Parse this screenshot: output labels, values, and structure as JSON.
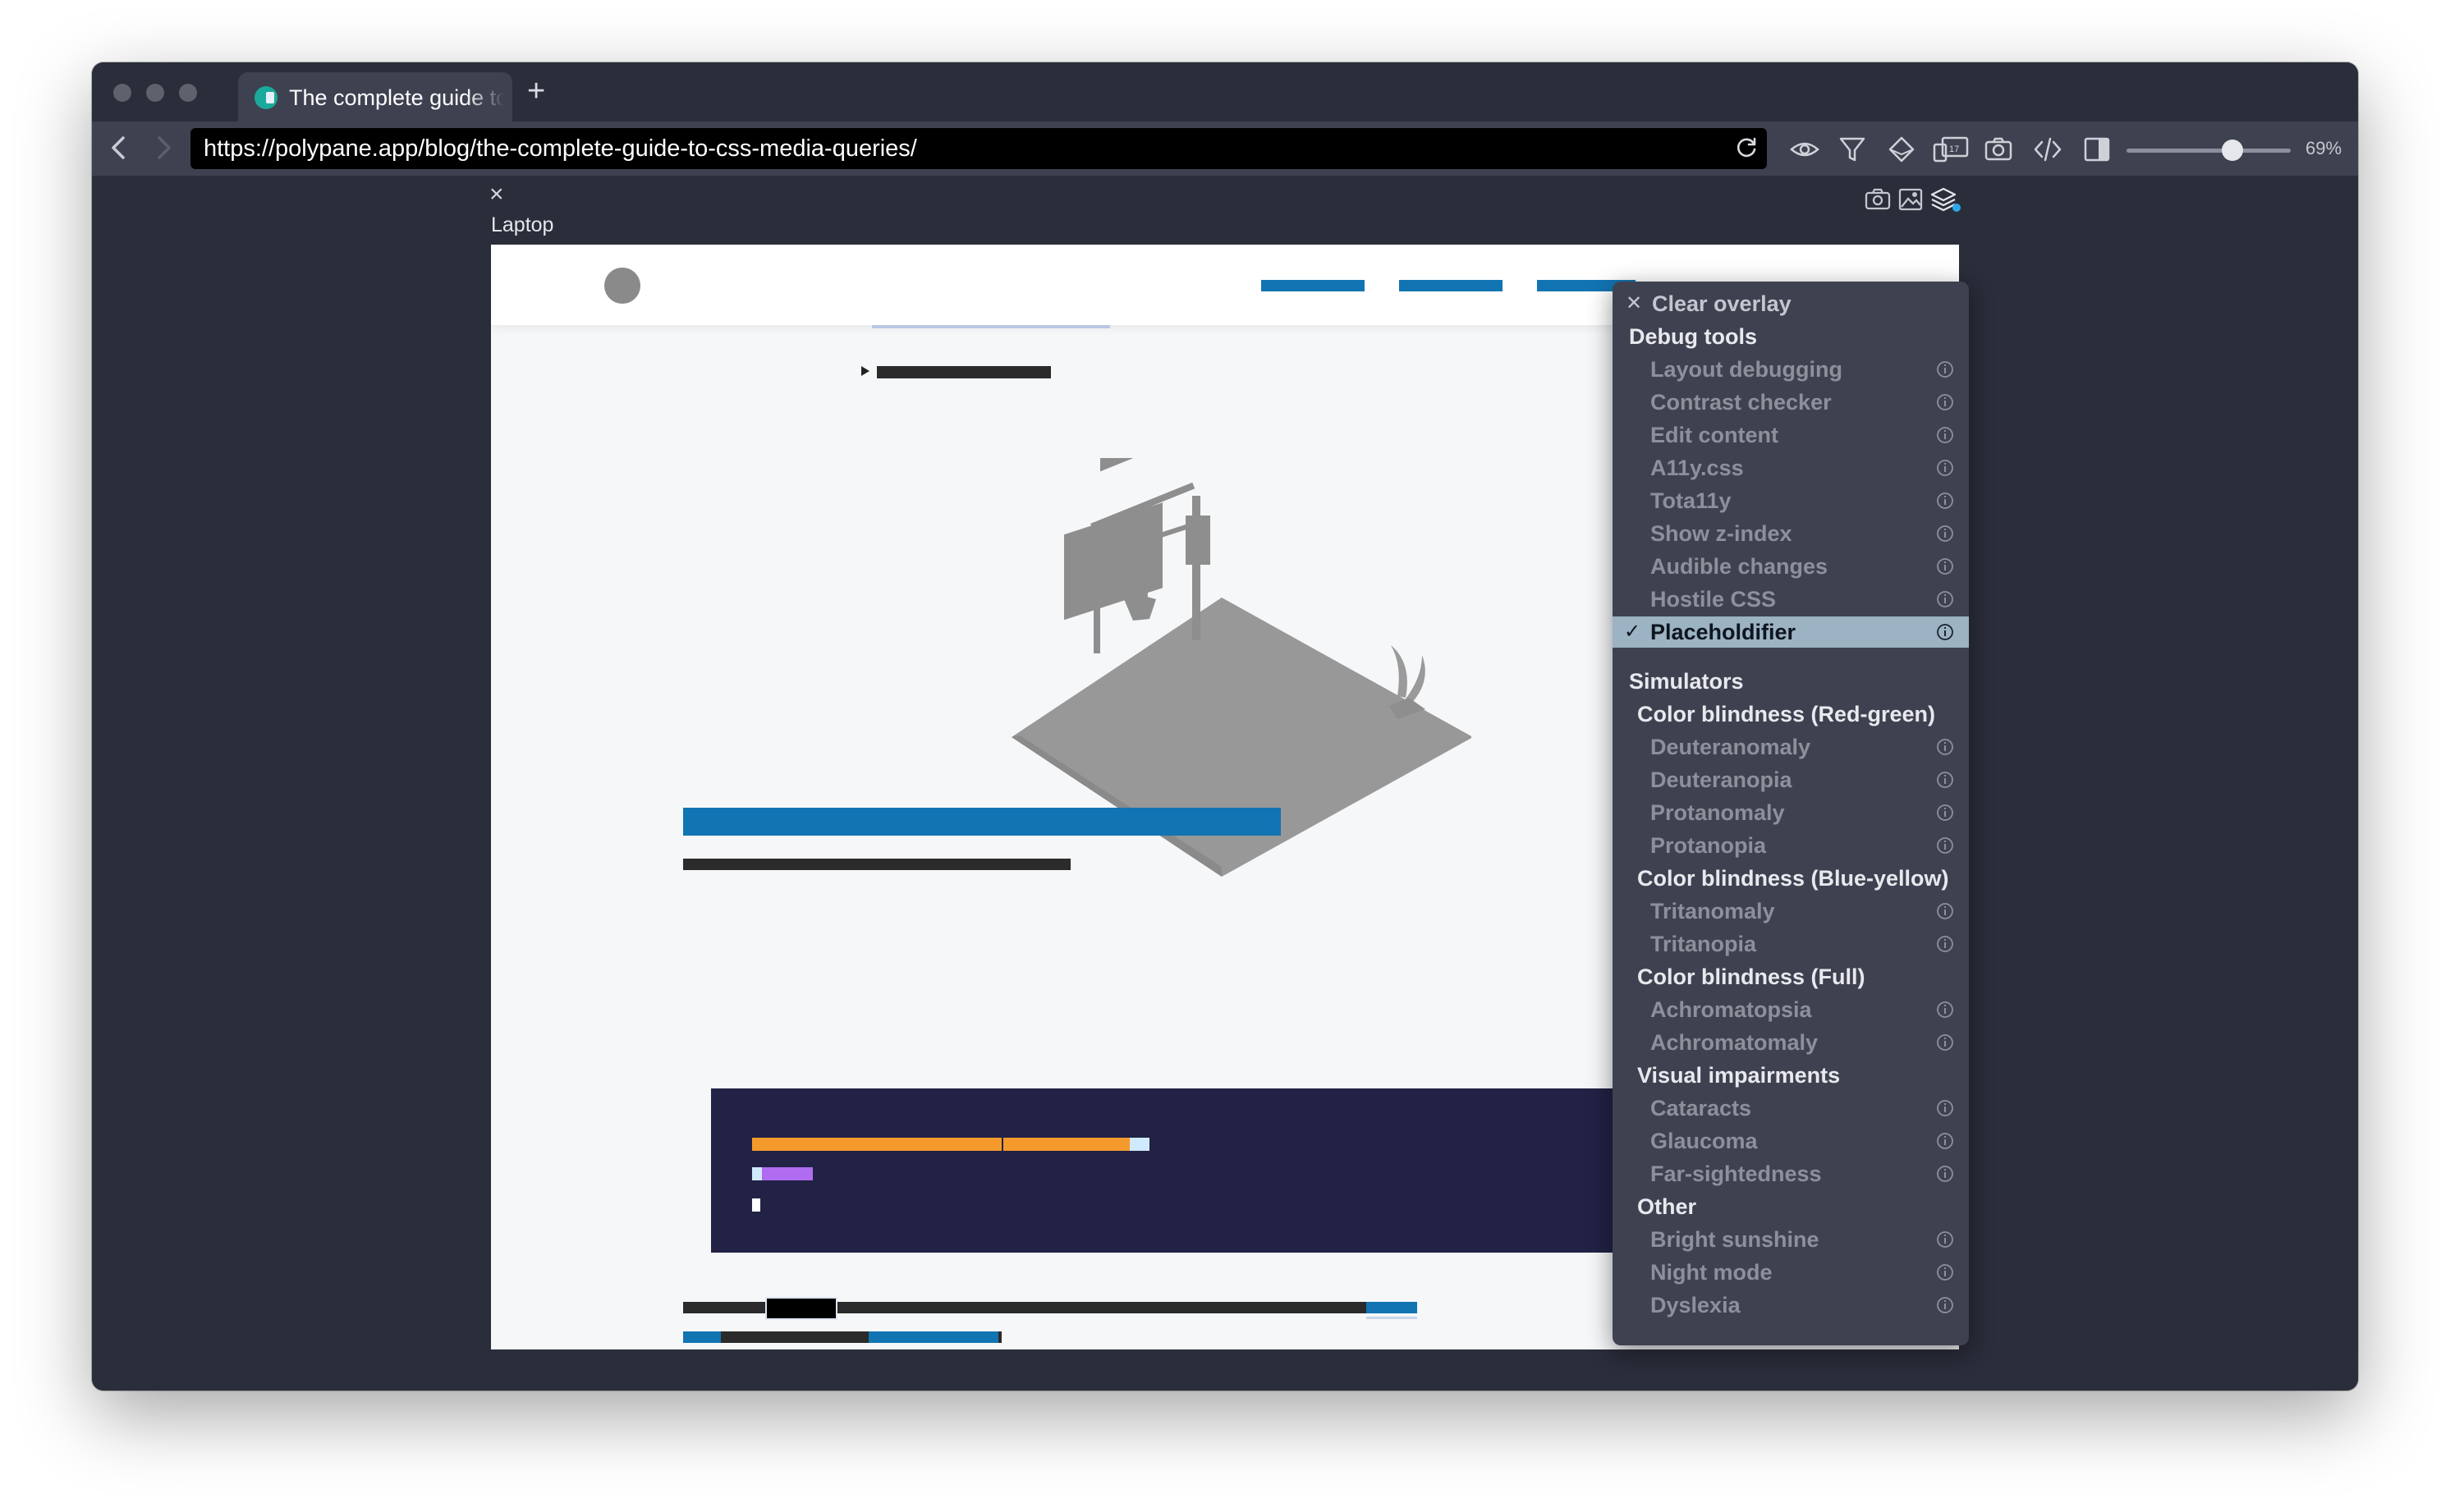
{
  "browser": {
    "tab": {
      "title": "The complete guide to CSS media queries",
      "favicon": "polypane-icon"
    },
    "new_tab_label": "+",
    "url": "https://polypane.app/blog/the-complete-guide-to-css-media-queries/",
    "zoom": {
      "label": "69%",
      "level": 0.69
    },
    "toolbar_icons": [
      "eye-icon",
      "filter-icon",
      "layers-icon",
      "devices-icon",
      "camera-icon",
      "code-icon",
      "sidebar-icon"
    ]
  },
  "pane": {
    "close_label": "×",
    "device_label": "Laptop",
    "tool_icons": [
      "screenshot-icon",
      "image-icon",
      "overlay-icon"
    ]
  },
  "menu": {
    "clear_overlay": "Clear overlay",
    "debug_heading": "Debug tools",
    "debug_items": [
      "Layout debugging",
      "Contrast checker",
      "Edit content",
      "A11y.css",
      "Tota11y",
      "Show z-index",
      "Audible changes",
      "Hostile CSS",
      "Placeholdifier"
    ],
    "selected_item": "Placeholdifier",
    "simulators_heading": "Simulators",
    "groups": [
      {
        "heading": "Color blindness (Red-green)",
        "items": [
          "Deuteranomaly",
          "Deuteranopia",
          "Protanomaly",
          "Protanopia"
        ]
      },
      {
        "heading": "Color blindness (Blue-yellow)",
        "items": [
          "Tritanomaly",
          "Tritanopia"
        ]
      },
      {
        "heading": "Color blindness (Full)",
        "items": [
          "Achromatopsia",
          "Achromatomaly"
        ]
      },
      {
        "heading": "Visual impairments",
        "items": [
          "Cataracts",
          "Glaucoma",
          "Far-sightedness"
        ]
      },
      {
        "heading": "Other",
        "items": [
          "Bright sunshine",
          "Night mode",
          "Dyslexia"
        ]
      }
    ]
  },
  "colors": {
    "chrome": "#2a2d3a",
    "toolbar": "#3e4250",
    "accent_blue": "#1274b2",
    "selected": "#9bb3c2",
    "code_bg": "#212245",
    "code_orange": "#f49a2c",
    "code_purple": "#b06cf0"
  }
}
